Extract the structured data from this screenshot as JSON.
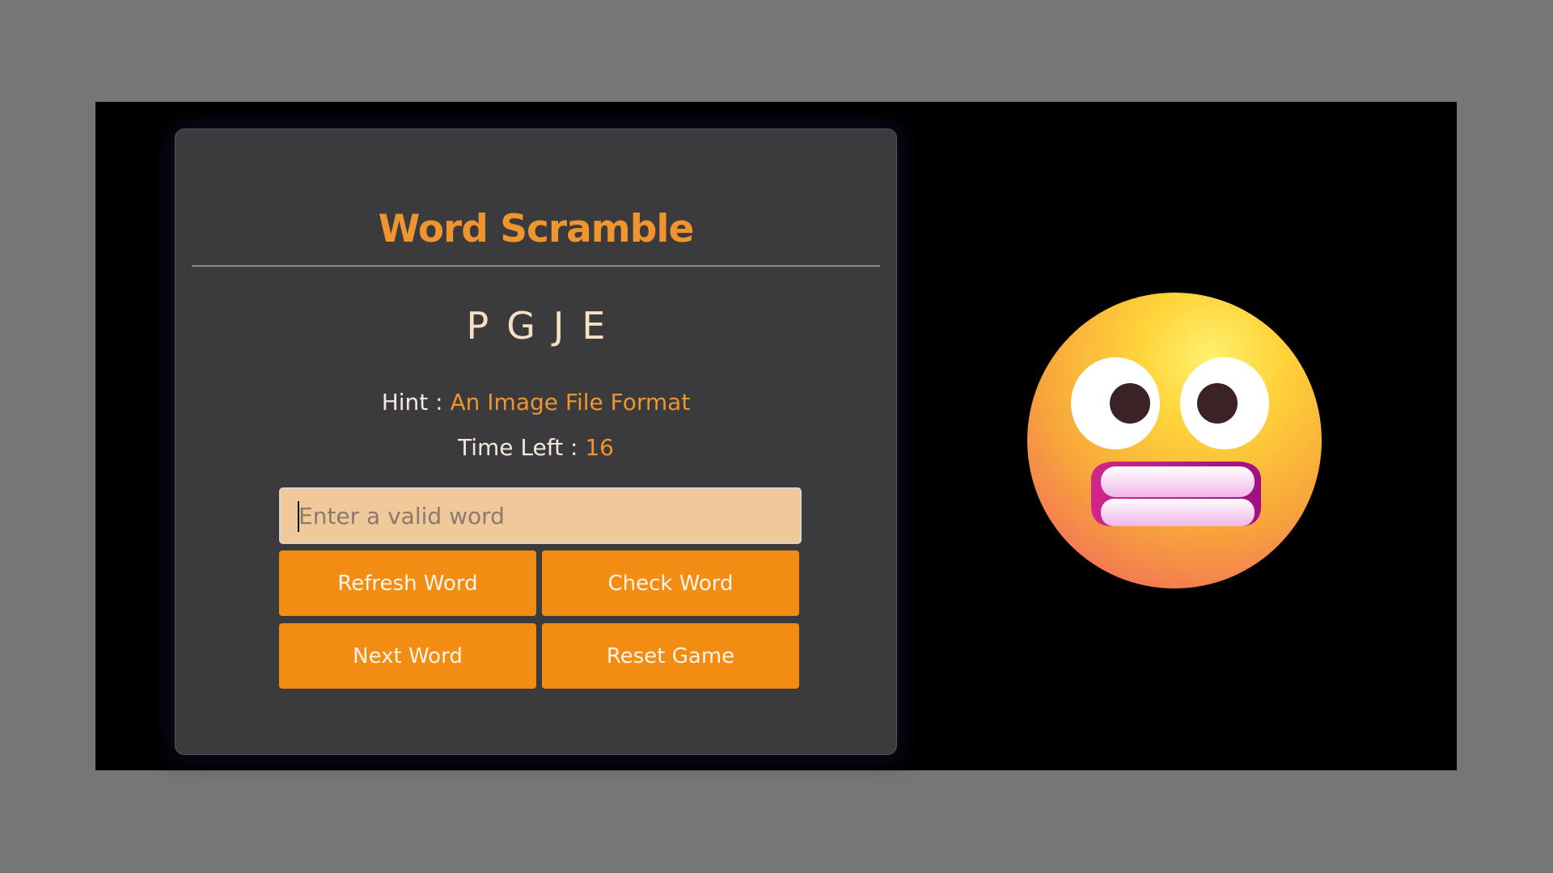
{
  "game": {
    "title": "Word Scramble",
    "scrambled_word": "PGJE",
    "hint_label": "Hint : ",
    "hint_value": "An Image File Format",
    "time_label": "Time Left : ",
    "time_value": "16",
    "input_value": "",
    "input_placeholder": "Enter a valid word",
    "buttons": {
      "refresh": "Refresh Word",
      "check": "Check Word",
      "next": "Next Word",
      "reset": "Reset Game"
    }
  },
  "side_image": {
    "icon": "grimacing-face-emoji"
  },
  "colors": {
    "accent": "#ef9530",
    "button": "#f38c12",
    "card": "#3b3a3c",
    "input_bg": "#f0c99a",
    "page_bg": "#767676",
    "stage_bg": "#000000"
  }
}
